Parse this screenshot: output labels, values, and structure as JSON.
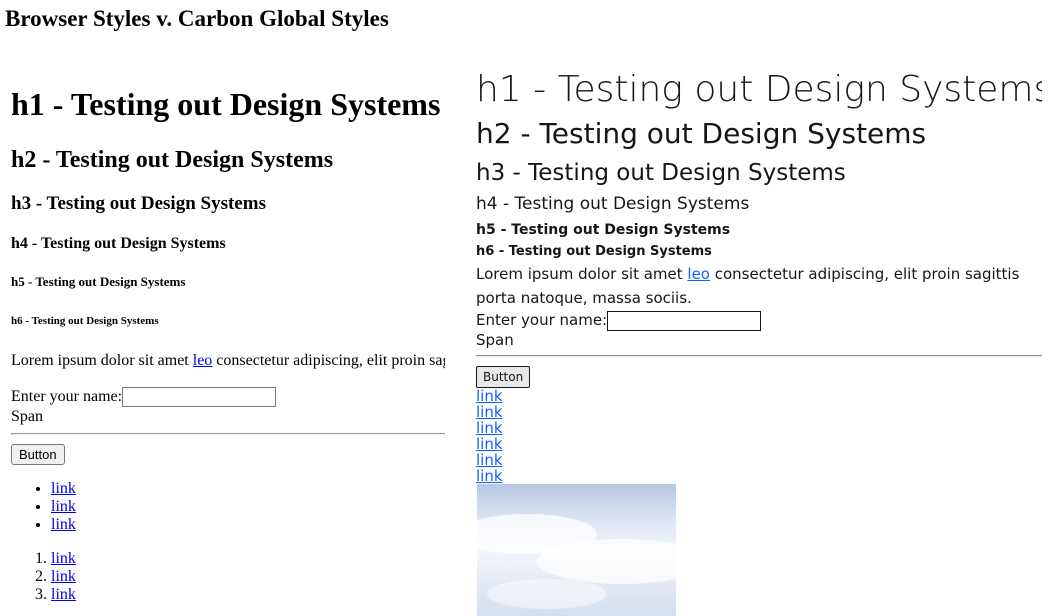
{
  "page": {
    "title": "Browser Styles v. Carbon Global Styles"
  },
  "headings": {
    "h1": "h1 - Testing out Design Systems",
    "h2": "h2 - Testing out Design Systems",
    "h3": "h3 - Testing out Design Systems",
    "h4": "h4 - Testing out Design Systems",
    "h5": "h5 - Testing out Design Systems",
    "h6": "h6 - Testing out Design Systems"
  },
  "paragraph": {
    "before_link": "Lorem ipsum dolor sit amet ",
    "link": "leo",
    "after_link": " consectetur adipiscing, elit proin sagittis porta natoque, massa sociis."
  },
  "form": {
    "label": "Enter your name:",
    "value": ""
  },
  "span_text": "Span",
  "button_label": "Button",
  "lists": {
    "unordered": [
      "link",
      "link",
      "link"
    ],
    "ordered": [
      "link",
      "link",
      "link"
    ]
  },
  "colors": {
    "browser_link": "#0000ee",
    "carbon_link": "#0f62fe",
    "carbon_text": "#161616"
  }
}
